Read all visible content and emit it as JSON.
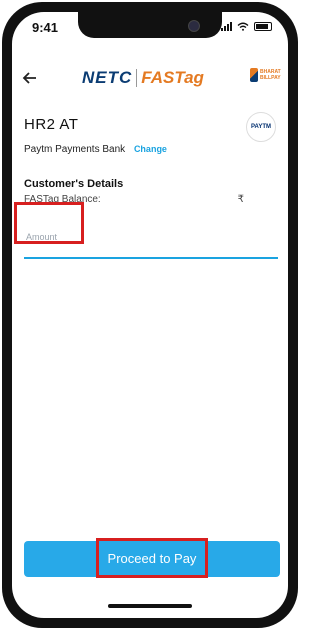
{
  "status_bar": {
    "time": "9:41"
  },
  "header": {
    "back_icon": "arrow-left-icon",
    "logo_netc": "NETC",
    "logo_fastag": "FASTag",
    "logo_bbps": "BHARAT BILLPAY"
  },
  "vehicle": {
    "number": "HR2  AT"
  },
  "bank": {
    "name": "Paytm Payments Bank",
    "change_label": "Change",
    "logo_text": "PAYTM"
  },
  "customer": {
    "title": "Customer's Details",
    "balance_label": "FASTag Balance:",
    "currency_symbol": "₹"
  },
  "amount": {
    "placeholder": "Amount",
    "value": ""
  },
  "actions": {
    "proceed_label": "Proceed to Pay"
  },
  "colors": {
    "accent": "#28a9e8",
    "link": "#1aa3e0",
    "highlight": "#d71f1f"
  }
}
